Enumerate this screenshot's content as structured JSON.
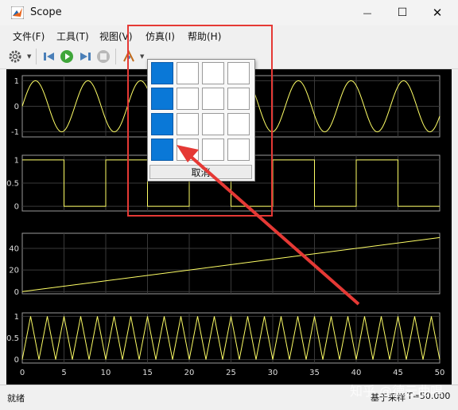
{
  "window": {
    "title": "Scope",
    "min_glyph": "—",
    "max_glyph": "☐",
    "close_glyph": "✕"
  },
  "menu": {
    "items": [
      "文件(F)",
      "工具(T)",
      "视图(V)",
      "仿真(I)",
      "帮助(H)"
    ]
  },
  "toolbar": {
    "icons": [
      "settings-icon",
      "step-back-icon",
      "run-icon",
      "step-forward-icon",
      "stop-icon",
      "highlight-icon",
      "zoom-icon",
      "autoscale-icon",
      "layout-icon",
      "draw-icon"
    ]
  },
  "layout_popup": {
    "rows": 4,
    "cols": 4,
    "selected_rows": 4,
    "selected_cols": 1,
    "cancel_label": "取消"
  },
  "status": {
    "left": "就绪",
    "mid": "基于采样",
    "right": "T=50.000"
  },
  "watermark": "知乎 @德云曲唱",
  "colors": {
    "signal": "#ffff66",
    "grid": "#3a3a3a",
    "axes_text": "#dddddd",
    "selection": "#0a78d7",
    "annotation": "#e53935"
  },
  "chart_data": [
    {
      "type": "line",
      "name": "sine",
      "x": [
        0,
        50
      ],
      "ylim": [
        -1.2,
        1.2
      ],
      "yticks": [
        -1,
        0,
        1
      ],
      "period": 6.3,
      "amplitude": 1,
      "y_at_0": 0
    },
    {
      "type": "line",
      "name": "square",
      "ylim": [
        -0.1,
        1.1
      ],
      "yticks": [
        0,
        0.5,
        1
      ],
      "x": [
        0,
        5,
        5,
        10,
        10,
        15,
        15,
        20,
        20,
        25,
        25,
        30,
        30,
        35,
        35,
        40,
        40,
        45,
        45,
        50
      ],
      "y": [
        1,
        1,
        0,
        0,
        1,
        1,
        0,
        0,
        1,
        1,
        0,
        0,
        1,
        1,
        0,
        0,
        1,
        1,
        0,
        0
      ]
    },
    {
      "type": "line",
      "name": "ramp",
      "ylim": [
        -2,
        54
      ],
      "yticks": [
        0,
        20,
        40
      ],
      "x": [
        0,
        50
      ],
      "y": [
        0,
        50
      ]
    },
    {
      "type": "line",
      "name": "triangle",
      "ylim": [
        -0.08,
        1.08
      ],
      "yticks": [
        0,
        0.5,
        1
      ],
      "x": [
        0,
        50
      ],
      "period": 2,
      "xticks": [
        0,
        5,
        10,
        15,
        20,
        25,
        30,
        35,
        40,
        45,
        50
      ]
    }
  ]
}
